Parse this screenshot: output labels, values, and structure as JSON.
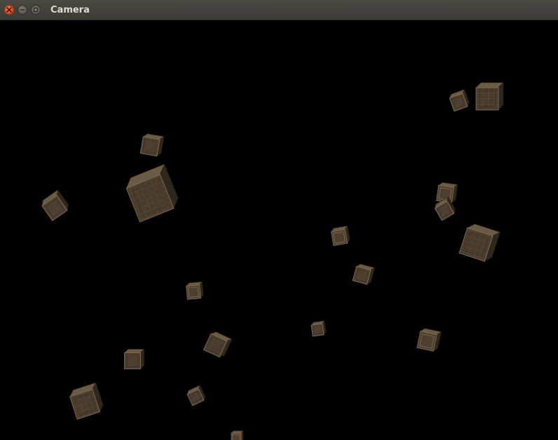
{
  "window": {
    "title": "Camera",
    "controls": [
      {
        "name": "close",
        "icon": "close-icon",
        "color": "#dd4814"
      },
      {
        "name": "minimize",
        "icon": "minimize-icon",
        "color": "#5b5953"
      },
      {
        "name": "maximize",
        "icon": "maximize-icon",
        "color": "#5b5953"
      }
    ]
  },
  "scene": {
    "background": "#000000",
    "object": "wooden-crate",
    "crate_colors": {
      "light": "#6b5a44",
      "mid": "#4d3f2f",
      "dark": "#2f261c",
      "edge": "#8a7458"
    }
  }
}
